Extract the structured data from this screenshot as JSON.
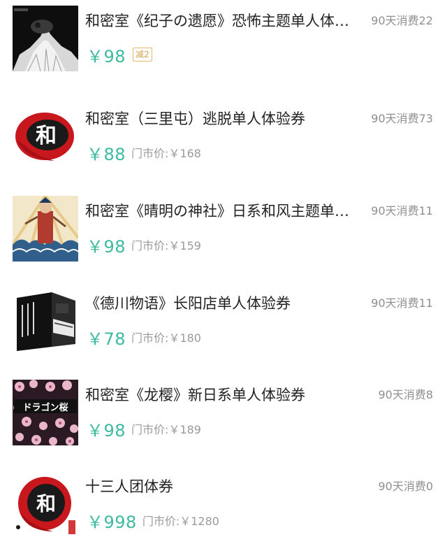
{
  "items": [
    {
      "title": "和密室《纪子の遗愿》恐怖主题单人体验券",
      "sales": "90天消费22",
      "price": "￥98",
      "badge": "减2",
      "original_price": "",
      "thumb_icon": "dark-horror-poster-image"
    },
    {
      "title": "和密室（三里屯）逃脱单人体验券",
      "sales": "90天消费73",
      "price": "￥88",
      "badge": "",
      "original_price": "门市价:￥168",
      "thumb_icon": "he-logo-image"
    },
    {
      "title": "和密室《晴明の神社》日系和风主题单人体验券",
      "sales": "90天消费11",
      "price": "￥98",
      "badge": "",
      "original_price": "门市价:￥159",
      "thumb_icon": "ukiyoe-poster-image"
    },
    {
      "title": "《德川物语》长阳店单人体验券",
      "sales": "90天消费11",
      "price": "￥78",
      "badge": "",
      "original_price": "门市价:￥180",
      "thumb_icon": "game-box-image"
    },
    {
      "title": "和密室《龙樱》新日系单人体验券",
      "sales": "90天消费8",
      "price": "￥98",
      "badge": "",
      "original_price": "门市价:￥189",
      "thumb_icon": "sakura-poster-image"
    },
    {
      "title": "十三人团体券",
      "sales": "90天消费0",
      "price": "￥998",
      "badge": "",
      "original_price": "门市价:￥1280",
      "thumb_icon": "he-logo-image"
    }
  ],
  "colors": {
    "price": "#3cbba0",
    "muted": "#8f8f8f",
    "title": "#222222",
    "badge": "#d4a04a"
  },
  "logo_text": "和",
  "poster_text": "ドラゴン桜"
}
